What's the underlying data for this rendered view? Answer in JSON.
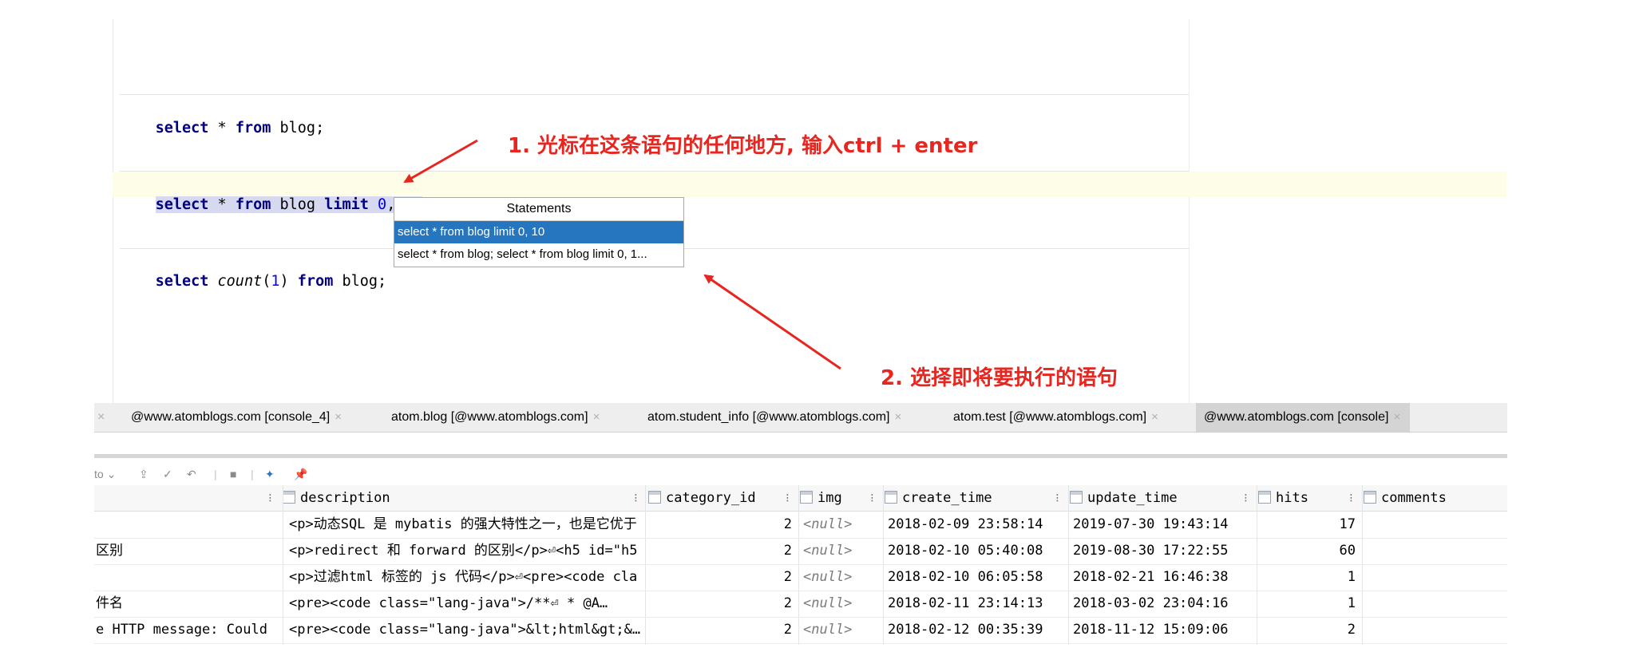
{
  "editor": {
    "lines": {
      "l1": {
        "kw1": "select",
        "star": " * ",
        "kw2": "from",
        "rest": " blog;"
      },
      "l2": {
        "kw1": "select",
        "star": " * ",
        "kw2": "from",
        "tbl": " blog ",
        "kw3": "limit",
        "sp": " ",
        "n1": "0",
        "comma": ", ",
        "n2": "10",
        "semi": ";"
      },
      "l3": {
        "kw1": "select",
        "fn": "count",
        "paren1": "(",
        "n": "1",
        "paren2": ") ",
        "kw2": "from",
        "rest": " blog;"
      }
    },
    "popup": {
      "title": "Statements",
      "items": [
        "select * from blog limit 0, 10",
        "select * from blog; select * from blog limit 0, 1..."
      ]
    }
  },
  "annotations": {
    "a1": "1. 光标在这条语句的任何地方, 输入ctrl + enter",
    "a2": "2. 选择即将要执行的语句",
    "color": "#e8251f"
  },
  "tabs": [
    "@www.atomblogs.com [console_4]",
    "atom.blog [@www.atomblogs.com]",
    "atom.student_info [@www.atomblogs.com]",
    "atom.test [@www.atomblogs.com]",
    "@www.atomblogs.com [console]"
  ],
  "toolbar": {
    "tx_mode": "to"
  },
  "grid": {
    "columns": [
      "description",
      "category_id",
      "img",
      "create_time",
      "update_time",
      "hits",
      "comments"
    ],
    "rows": [
      {
        "title": "",
        "description": "<p>动态SQL 是 mybatis 的强大特性之一，也是它优于",
        "category_id": "2",
        "img": "<null>",
        "create_time": "2018-02-09 23:58:14",
        "update_time": "2019-07-30 19:43:14",
        "hits": "17"
      },
      {
        "title": "区别",
        "description": "<p>redirect 和 forward 的区别</p>⏎<h5 id=\"h5",
        "category_id": "2",
        "img": "<null>",
        "create_time": "2018-02-10 05:40:08",
        "update_time": "2019-08-30 17:22:55",
        "hits": "60"
      },
      {
        "title": "",
        "description": "<p>过滤html 标签的 js 代码</p>⏎<pre><code cla",
        "category_id": "2",
        "img": "<null>",
        "create_time": "2018-02-10 06:05:58",
        "update_time": "2018-02-21 16:46:38",
        "hits": "1"
      },
      {
        "title": "件名",
        "description": "<pre><code class=\"lang-java\">/**⏎      * @A…",
        "category_id": "2",
        "img": "<null>",
        "create_time": "2018-02-11 23:14:13",
        "update_time": "2018-03-02 23:04:16",
        "hits": "1"
      },
      {
        "title": "e HTTP message: Could",
        "description": "<pre><code class=\"lang-java\">&lt;html&gt;&…",
        "category_id": "2",
        "img": "<null>",
        "create_time": "2018-02-12 00:35:39",
        "update_time": "2018-11-12 15:09:06",
        "hits": "2"
      }
    ]
  }
}
